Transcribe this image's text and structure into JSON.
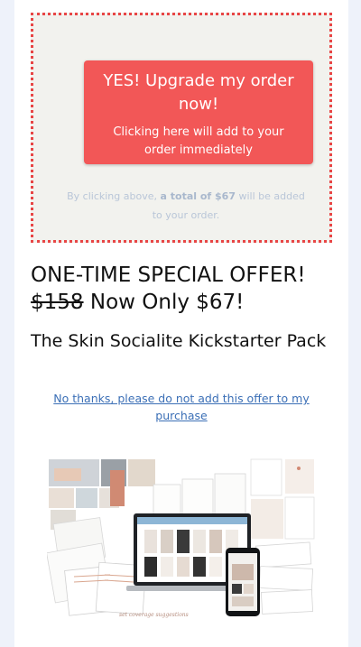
{
  "offer": {
    "button_title": "YES! Upgrade my order now!",
    "button_subtitle": "Clicking here will add to your order immediately",
    "disclaimer_prefix": "By clicking above, ",
    "disclaimer_bold": "a total of $67",
    "disclaimer_suffix": " will be added to your order."
  },
  "headline": {
    "line1": "ONE-TIME SPECIAL OFFER!",
    "old_price": "$158",
    "new_price_text": " Now Only $67!"
  },
  "product": {
    "name": "The Skin Socialite Kickstarter Pack",
    "image_caption": "set coverage suggestions"
  },
  "decline_link": "No thanks, please do not add this offer to my purchase",
  "colors": {
    "accent": "#f25757",
    "border": "#e84545",
    "link": "#3b6fb6",
    "background": "#eef2fa"
  }
}
